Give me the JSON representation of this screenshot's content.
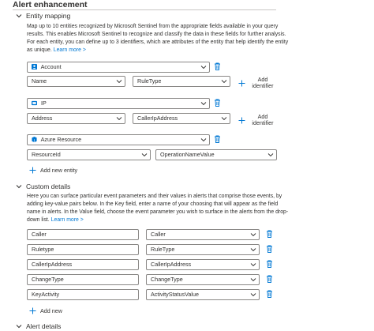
{
  "page": {
    "title": "Alert enhancement"
  },
  "entity_mapping": {
    "header": "Entity mapping",
    "description": "Map up to 10 entities recognized by Microsoft Sentinel from the appropriate fields available in your query results. This enables Microsoft Sentinel to recognize and classify the data in these fields for further analysis. For each entity, you can define up to 3 identifiers, which are attributes of the entity that help identify the entity as unique.",
    "learn_more": "Learn more >",
    "entities": [
      {
        "type": "Account",
        "icon": "account-icon",
        "identifier": "Name",
        "column": "RuleType",
        "add_identifier": "Add identifier"
      },
      {
        "type": "IP",
        "icon": "ip-icon",
        "identifier": "Address",
        "column": "CallerIpAddress",
        "add_identifier": "Add identifier"
      },
      {
        "type": "Azure Resource",
        "icon": "azure-resource-icon",
        "identifier": "ResourceId",
        "column": "OperationNameValue"
      }
    ],
    "add_new_entity": "Add new entity"
  },
  "custom_details": {
    "header": "Custom details",
    "description": "Here you can surface particular event parameters and their values in alerts that comprise those events, by adding key-value pairs below. In the Key field, enter a name of your choosing that will appear as the field name in alerts. In the Value field, choose the event parameter you wish to surface in the alerts from the drop-down list.",
    "learn_more": "Learn more >",
    "rows": [
      {
        "key": "Caller",
        "value": "Caller"
      },
      {
        "key": "Ruletype",
        "value": "RuleType"
      },
      {
        "key": "CallerIpAddress",
        "value": "CallerIpAddress"
      },
      {
        "key": "ChangeType",
        "value": "ChangeType"
      },
      {
        "key": "KeyActivity",
        "value": "ActivityStatusValue"
      }
    ],
    "add_new": "Add new"
  },
  "alert_details": {
    "header": "Alert details"
  },
  "colors": {
    "accent": "#0078d4",
    "border": "#8a8886",
    "text": "#323130"
  }
}
